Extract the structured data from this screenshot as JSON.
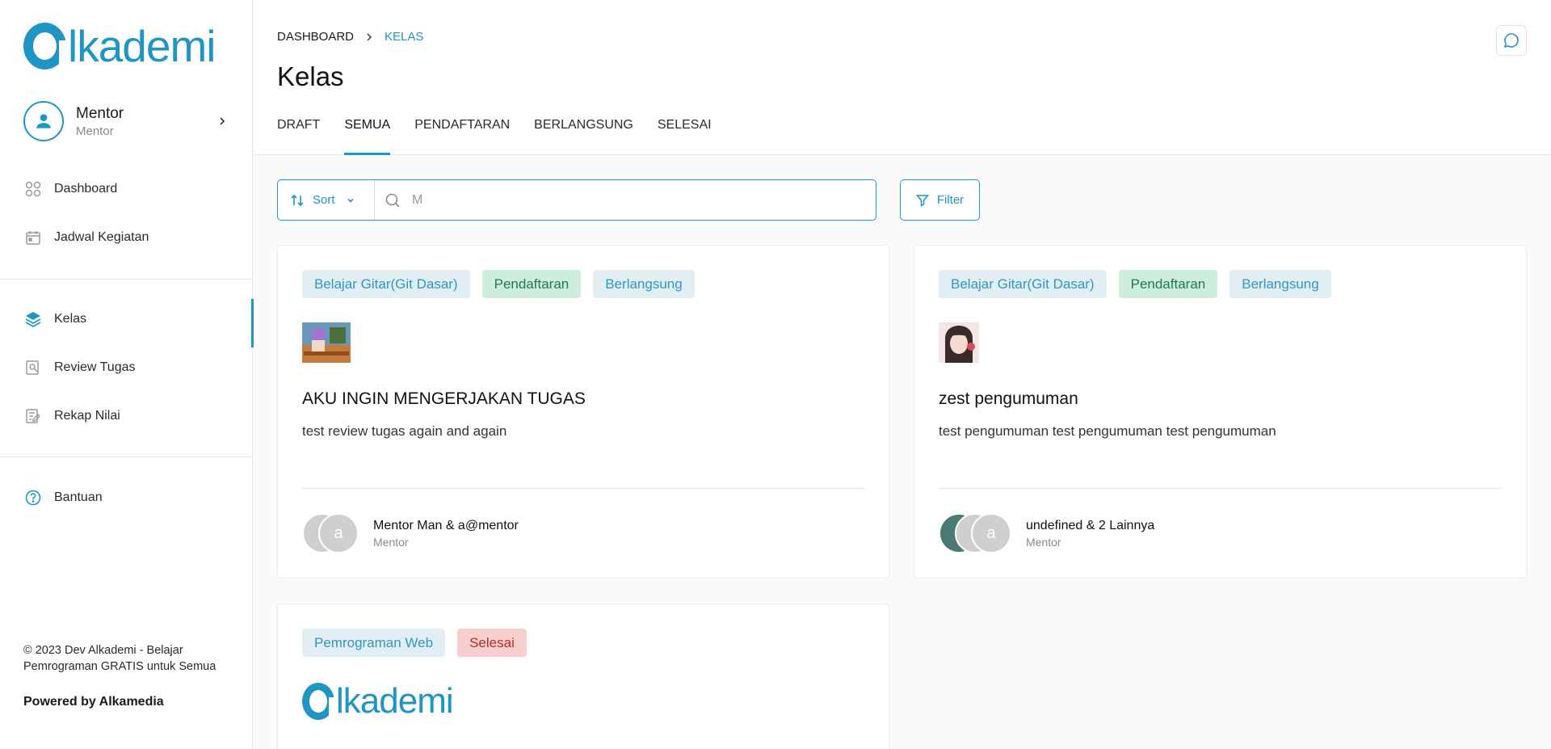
{
  "brand": {
    "logo_text": "lkademi",
    "accent": "#1f95c4"
  },
  "sidebar": {
    "profile": {
      "name": "Mentor",
      "role": "Mentor"
    },
    "nav_top": [
      {
        "label": "Dashboard",
        "icon": "dashboard-icon"
      },
      {
        "label": "Jadwal Kegiatan",
        "icon": "calendar-icon"
      }
    ],
    "nav_main": [
      {
        "label": "Kelas",
        "icon": "layers-icon",
        "active": true
      },
      {
        "label": "Review Tugas",
        "icon": "review-icon"
      },
      {
        "label": "Rekap Nilai",
        "icon": "edit-note-icon"
      }
    ],
    "nav_help": {
      "label": "Bantuan",
      "icon": "help-icon"
    },
    "footer_text": "© 2023 Dev Alkademi - Belajar Pemrograman GRATIS untuk Semua",
    "powered": "Powered by Alkamedia"
  },
  "header": {
    "breadcrumb": [
      "DASHBOARD",
      "KELAS"
    ],
    "title": "Kelas",
    "tabs": [
      {
        "label": "DRAFT",
        "active": false
      },
      {
        "label": "SEMUA",
        "active": true
      },
      {
        "label": "PENDAFTARAN",
        "active": false
      },
      {
        "label": "BERLANGSUNG",
        "active": false
      },
      {
        "label": "SELESAI",
        "active": false
      }
    ]
  },
  "toolbar": {
    "sort_label": "Sort",
    "search_value": "M",
    "filter_label": "Filter"
  },
  "cards": [
    {
      "tags": [
        "Belajar Gitar(Git Dasar)",
        "Pendaftaran",
        "Berlangsung"
      ],
      "title": "AKU INGIN MENGERJAKAN TUGAS",
      "description": "test review tugas again and again",
      "mentor_initials": [
        "",
        "a"
      ],
      "mentor_names": "Mentor Man & a@mentor",
      "mentor_role": "Mentor"
    },
    {
      "tags": [
        "Belajar Gitar(Git Dasar)",
        "Pendaftaran",
        "Berlangsung"
      ],
      "title": "zest pengumuman",
      "description": "test pengumuman test pengumuman test pengumuman",
      "mentor_initials": [
        "",
        "",
        "a"
      ],
      "mentor_names": "undefined & 2 Lainnya",
      "mentor_role": "Mentor"
    },
    {
      "tags": [
        "Pemrograman Web",
        "Selesai"
      ],
      "logo_text": "lkademi"
    }
  ]
}
